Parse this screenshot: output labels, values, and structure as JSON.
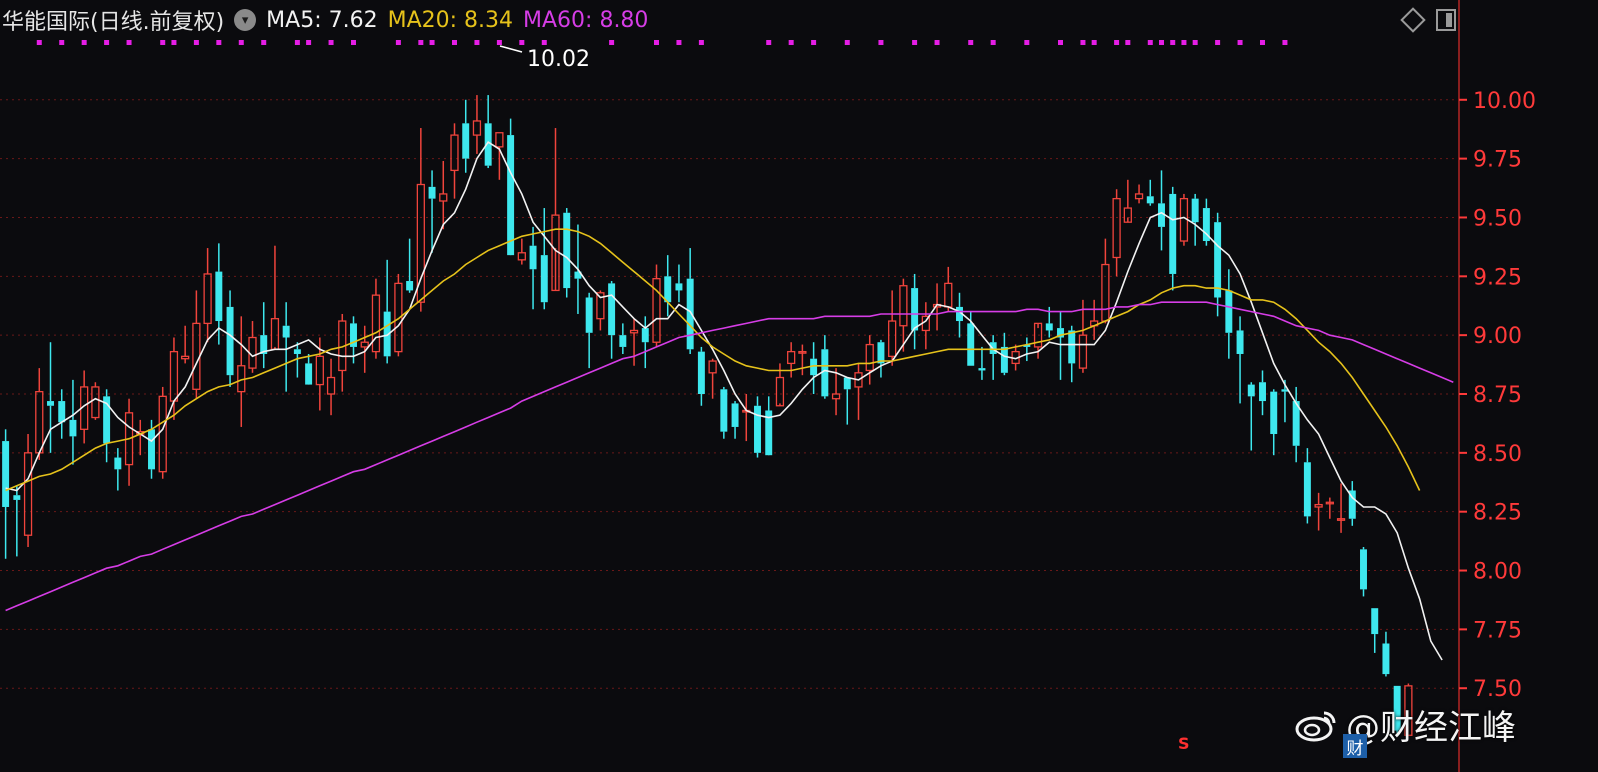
{
  "header": {
    "title": "华能国际(日线.前复权)",
    "ma5": "MA5: 7.62",
    "ma20": "MA20: 8.34",
    "ma60": "MA60: 8.80"
  },
  "watermark": {
    "text": "@财经江峰",
    "badge": "财",
    "marker": "S"
  },
  "icons": [
    "dropdown-icon",
    "diamond-icon",
    "panel-toggle-icon",
    "weibo-icon"
  ],
  "colors": {
    "background": "#0b0b0e",
    "up": "#f0443c",
    "down": "#3ee8ee",
    "ma5": "#f2f2f2",
    "ma20": "#e6c21b",
    "ma60": "#d63de6",
    "grid": "#6a1818",
    "axis_text": "#ff3a3a",
    "markers": "#e61ee6"
  },
  "chart_data": {
    "type": "candlestick",
    "title": "华能国际(日线.前复权)",
    "ylim": [
      7.28,
      10.22
    ],
    "y_ticks": [
      "10.00",
      "9.75",
      "9.50",
      "9.25",
      "9.00",
      "8.75",
      "8.50",
      "8.25",
      "8.00",
      "7.75",
      "7.50"
    ],
    "y_tick_values": [
      10.0,
      9.75,
      9.5,
      9.25,
      9.0,
      8.75,
      8.5,
      8.25,
      8.0,
      7.75,
      7.5
    ],
    "high_annotation": "10.02",
    "candles": [
      [
        8.55,
        8.27,
        8.05,
        8.6
      ],
      [
        8.32,
        8.3,
        8.06,
        8.36
      ],
      [
        8.15,
        8.5,
        8.1,
        8.58
      ],
      [
        8.5,
        8.76,
        8.47,
        8.86
      ],
      [
        8.72,
        8.7,
        8.5,
        8.97
      ],
      [
        8.72,
        8.63,
        8.56,
        8.77
      ],
      [
        8.64,
        8.57,
        8.45,
        8.81
      ],
      [
        8.6,
        8.78,
        8.54,
        8.85
      ],
      [
        8.65,
        8.78,
        8.64,
        8.8
      ],
      [
        8.74,
        8.54,
        8.46,
        8.77
      ],
      [
        8.48,
        8.43,
        8.34,
        8.52
      ],
      [
        8.45,
        8.67,
        8.36,
        8.73
      ],
      [
        8.58,
        8.59,
        8.49,
        8.64
      ],
      [
        8.6,
        8.43,
        8.39,
        8.64
      ],
      [
        8.42,
        8.74,
        8.39,
        8.78
      ],
      [
        8.72,
        8.93,
        8.64,
        8.99
      ],
      [
        8.9,
        8.91,
        8.88,
        9.04
      ],
      [
        8.77,
        9.05,
        8.73,
        9.19
      ],
      [
        9.05,
        9.26,
        8.97,
        9.37
      ],
      [
        9.27,
        9.06,
        8.96,
        9.39
      ],
      [
        9.12,
        8.83,
        8.78,
        9.19
      ],
      [
        8.76,
        8.87,
        8.61,
        9.08
      ],
      [
        8.86,
        8.99,
        8.84,
        9.06
      ],
      [
        9.0,
        8.92,
        8.86,
        9.14
      ],
      [
        8.94,
        9.07,
        8.95,
        9.38
      ],
      [
        9.04,
        8.99,
        8.76,
        9.14
      ],
      [
        8.94,
        8.92,
        8.82,
        8.97
      ],
      [
        8.88,
        8.79,
        8.8,
        8.92
      ],
      [
        8.79,
        8.91,
        8.68,
        8.99
      ],
      [
        8.75,
        8.82,
        8.66,
        8.9
      ],
      [
        8.85,
        9.06,
        8.76,
        9.09
      ],
      [
        9.05,
        8.95,
        8.88,
        9.08
      ],
      [
        8.95,
        8.97,
        8.84,
        9.04
      ],
      [
        8.93,
        9.17,
        8.9,
        9.24
      ],
      [
        9.1,
        8.91,
        8.88,
        9.32
      ],
      [
        8.93,
        9.22,
        8.91,
        9.26
      ],
      [
        9.23,
        9.19,
        9.18,
        9.41
      ],
      [
        9.14,
        9.64,
        9.1,
        9.88
      ],
      [
        9.63,
        9.58,
        9.35,
        9.7
      ],
      [
        9.57,
        9.6,
        9.45,
        9.74
      ],
      [
        9.7,
        9.85,
        9.58,
        9.9
      ],
      [
        9.9,
        9.75,
        9.69,
        10.0
      ],
      [
        9.85,
        9.91,
        9.77,
        10.02
      ],
      [
        9.9,
        9.72,
        9.71,
        10.02
      ],
      [
        9.8,
        9.86,
        9.66,
        9.86
      ],
      [
        9.85,
        9.34,
        9.44,
        9.92
      ],
      [
        9.32,
        9.35,
        9.3,
        9.41
      ],
      [
        9.38,
        9.28,
        9.11,
        9.46
      ],
      [
        9.34,
        9.14,
        9.11,
        9.54
      ],
      [
        9.19,
        9.51,
        9.37,
        9.88
      ],
      [
        9.52,
        9.2,
        9.16,
        9.54
      ],
      [
        9.27,
        9.24,
        9.09,
        9.47
      ],
      [
        9.16,
        9.01,
        8.86,
        9.18
      ],
      [
        9.07,
        9.18,
        9.02,
        9.19
      ],
      [
        9.22,
        9.0,
        8.9,
        9.23
      ],
      [
        9.0,
        8.95,
        8.92,
        9.05
      ],
      [
        9.01,
        9.02,
        8.87,
        9.07
      ],
      [
        9.03,
        8.97,
        8.86,
        9.08
      ],
      [
        8.97,
        9.24,
        8.95,
        9.3
      ],
      [
        9.25,
        9.14,
        9.08,
        9.34
      ],
      [
        9.22,
        9.19,
        9.14,
        9.3
      ],
      [
        9.24,
        8.94,
        8.92,
        9.37
      ],
      [
        8.93,
        8.75,
        8.7,
        8.95
      ],
      [
        8.84,
        8.89,
        8.73,
        8.9
      ],
      [
        8.77,
        8.59,
        8.56,
        8.78
      ],
      [
        8.71,
        8.61,
        8.56,
        8.72
      ],
      [
        8.68,
        8.68,
        8.55,
        8.75
      ],
      [
        8.7,
        8.5,
        8.48,
        8.74
      ],
      [
        8.68,
        8.49,
        8.52,
        8.74
      ],
      [
        8.7,
        8.82,
        8.71,
        8.88
      ],
      [
        8.88,
        8.93,
        8.82,
        8.97
      ],
      [
        8.93,
        8.93,
        8.83,
        8.96
      ],
      [
        8.9,
        8.83,
        8.75,
        8.97
      ],
      [
        8.94,
        8.74,
        8.73,
        9.0
      ],
      [
        8.73,
        8.75,
        8.66,
        8.86
      ],
      [
        8.82,
        8.77,
        8.62,
        8.82
      ],
      [
        8.78,
        8.84,
        8.64,
        8.88
      ],
      [
        8.85,
        8.96,
        8.79,
        9.0
      ],
      [
        8.97,
        8.88,
        8.82,
        8.98
      ],
      [
        8.91,
        9.06,
        8.87,
        9.19
      ],
      [
        9.04,
        9.21,
        8.93,
        9.24
      ],
      [
        9.2,
        9.02,
        8.94,
        9.26
      ],
      [
        9.02,
        9.08,
        8.94,
        9.14
      ],
      [
        9.12,
        9.13,
        9.02,
        9.22
      ],
      [
        9.12,
        9.22,
        9.1,
        9.29
      ],
      [
        9.12,
        9.06,
        8.99,
        9.18
      ],
      [
        9.05,
        8.87,
        8.87,
        9.1
      ],
      [
        8.86,
        8.85,
        8.81,
        8.95
      ],
      [
        8.97,
        8.92,
        8.81,
        9.0
      ],
      [
        8.95,
        8.84,
        8.83,
        9.01
      ],
      [
        8.88,
        8.93,
        8.85,
        8.96
      ],
      [
        8.96,
        8.95,
        8.89,
        8.99
      ],
      [
        8.95,
        9.05,
        8.9,
        9.03
      ],
      [
        9.05,
        9.02,
        8.99,
        9.12
      ],
      [
        9.03,
        8.99,
        8.81,
        9.1
      ],
      [
        9.02,
        8.88,
        8.8,
        9.04
      ],
      [
        8.86,
        9.0,
        8.84,
        9.15
      ],
      [
        9.04,
        9.06,
        8.98,
        9.15
      ],
      [
        9.06,
        9.3,
        9.05,
        9.41
      ],
      [
        9.33,
        9.58,
        9.25,
        9.62
      ],
      [
        9.48,
        9.54,
        9.5,
        9.66
      ],
      [
        9.58,
        9.6,
        9.56,
        9.64
      ],
      [
        9.59,
        9.56,
        9.55,
        9.66
      ],
      [
        9.56,
        9.46,
        9.36,
        9.7
      ],
      [
        9.6,
        9.26,
        9.19,
        9.63
      ],
      [
        9.4,
        9.58,
        9.38,
        9.6
      ],
      [
        9.58,
        9.48,
        9.38,
        9.6
      ],
      [
        9.54,
        9.4,
        9.38,
        9.58
      ],
      [
        9.48,
        9.16,
        9.08,
        9.52
      ],
      [
        9.19,
        9.01,
        8.9,
        9.28
      ],
      [
        9.02,
        8.92,
        8.71,
        9.08
      ],
      [
        8.79,
        8.74,
        8.51,
        8.8
      ],
      [
        8.8,
        8.72,
        8.66,
        8.85
      ],
      [
        8.76,
        8.58,
        8.49,
        8.77
      ],
      [
        8.77,
        8.76,
        8.63,
        8.81
      ],
      [
        8.72,
        8.53,
        8.46,
        8.78
      ],
      [
        8.46,
        8.23,
        8.2,
        8.52
      ],
      [
        8.27,
        8.28,
        8.17,
        8.33
      ],
      [
        8.29,
        8.29,
        8.22,
        8.31
      ],
      [
        8.22,
        8.22,
        8.16,
        8.37
      ],
      [
        8.34,
        8.22,
        8.19,
        8.38
      ],
      [
        8.09,
        7.92,
        7.89,
        8.1
      ],
      [
        7.84,
        7.73,
        7.65,
        7.84
      ],
      [
        7.69,
        7.56,
        7.55,
        7.74
      ],
      [
        7.51,
        7.32,
        7.31,
        7.51
      ],
      [
        7.3,
        7.51,
        7.3,
        7.52
      ]
    ],
    "series": [
      {
        "name": "MA5",
        "values": [
          8.35,
          8.34,
          8.39,
          8.5,
          8.6,
          8.63,
          8.66,
          8.7,
          8.73,
          8.71,
          8.65,
          8.61,
          8.58,
          8.55,
          8.6,
          8.72,
          8.78,
          8.88,
          8.98,
          9.03,
          9.0,
          8.96,
          8.91,
          8.93,
          8.94,
          8.94,
          8.96,
          8.98,
          8.94,
          8.92,
          8.91,
          8.91,
          8.93,
          8.99,
          9.0,
          9.04,
          9.11,
          9.24,
          9.36,
          9.47,
          9.52,
          9.62,
          9.75,
          9.82,
          9.79,
          9.69,
          9.6,
          9.48,
          9.42,
          9.36,
          9.33,
          9.28,
          9.21,
          9.16,
          9.17,
          9.12,
          9.07,
          9.03,
          9.07,
          9.07,
          9.13,
          9.1,
          9.02,
          8.94,
          8.85,
          8.75,
          8.68,
          8.66,
          8.65,
          8.66,
          8.71,
          8.77,
          8.82,
          8.85,
          8.84,
          8.82,
          8.81,
          8.84,
          8.87,
          8.89,
          8.96,
          9.03,
          9.06,
          9.13,
          9.12,
          9.1,
          9.06,
          9.0,
          8.94,
          8.91,
          8.9,
          8.92,
          8.93,
          8.97,
          8.96,
          8.96,
          8.96,
          8.96,
          9.02,
          9.14,
          9.27,
          9.39,
          9.5,
          9.52,
          9.49,
          9.5,
          9.47,
          9.43,
          9.38,
          9.34,
          9.26,
          9.14,
          9.01,
          8.88,
          8.79,
          8.71,
          8.64,
          8.58,
          8.48,
          8.38,
          8.31,
          8.27,
          8.27,
          8.24,
          8.16,
          8.01,
          7.88,
          7.7,
          7.62
        ]
      },
      {
        "name": "MA20",
        "values": [
          8.34,
          8.36,
          8.38,
          8.4,
          8.41,
          8.43,
          8.46,
          8.49,
          8.52,
          8.54,
          8.55,
          8.56,
          8.58,
          8.6,
          8.63,
          8.66,
          8.7,
          8.73,
          8.76,
          8.78,
          8.79,
          8.81,
          8.82,
          8.84,
          8.86,
          8.88,
          8.9,
          8.91,
          8.92,
          8.94,
          8.95,
          8.97,
          8.99,
          9.01,
          9.04,
          9.07,
          9.11,
          9.15,
          9.19,
          9.23,
          9.26,
          9.3,
          9.33,
          9.36,
          9.38,
          9.4,
          9.42,
          9.43,
          9.44,
          9.45,
          9.45,
          9.44,
          9.42,
          9.39,
          9.35,
          9.31,
          9.27,
          9.23,
          9.19,
          9.14,
          9.09,
          9.04,
          8.99,
          8.95,
          8.92,
          8.89,
          8.87,
          8.86,
          8.85,
          8.85,
          8.85,
          8.86,
          8.87,
          8.87,
          8.87,
          8.87,
          8.88,
          8.88,
          8.89,
          8.89,
          8.9,
          8.91,
          8.92,
          8.93,
          8.94,
          8.94,
          8.94,
          8.94,
          8.94,
          8.94,
          8.95,
          8.96,
          8.97,
          8.98,
          9.0,
          9.01,
          9.02,
          9.04,
          9.06,
          9.08,
          9.1,
          9.13,
          9.15,
          9.18,
          9.2,
          9.21,
          9.21,
          9.2,
          9.2,
          9.19,
          9.17,
          9.15,
          9.15,
          9.14,
          9.11,
          9.07,
          9.02,
          8.97,
          8.93,
          8.88,
          8.82,
          8.75,
          8.68,
          8.61,
          8.53,
          8.44,
          8.34
        ]
      },
      {
        "name": "MA60",
        "values": [
          7.83,
          7.85,
          7.87,
          7.89,
          7.91,
          7.93,
          7.95,
          7.97,
          7.99,
          8.01,
          8.02,
          8.04,
          8.06,
          8.07,
          8.09,
          8.11,
          8.13,
          8.15,
          8.17,
          8.19,
          8.21,
          8.23,
          8.24,
          8.26,
          8.28,
          8.3,
          8.32,
          8.34,
          8.36,
          8.38,
          8.4,
          8.42,
          8.43,
          8.45,
          8.47,
          8.49,
          8.51,
          8.53,
          8.55,
          8.57,
          8.59,
          8.61,
          8.63,
          8.65,
          8.67,
          8.69,
          8.72,
          8.74,
          8.76,
          8.78,
          8.8,
          8.82,
          8.84,
          8.86,
          8.88,
          8.9,
          8.91,
          8.93,
          8.95,
          8.97,
          8.99,
          9.0,
          9.01,
          9.02,
          9.03,
          9.04,
          9.05,
          9.06,
          9.07,
          9.07,
          9.07,
          9.07,
          9.07,
          9.08,
          9.08,
          9.08,
          9.08,
          9.08,
          9.09,
          9.09,
          9.09,
          9.09,
          9.09,
          9.09,
          9.1,
          9.1,
          9.1,
          9.1,
          9.1,
          9.1,
          9.1,
          9.11,
          9.11,
          9.1,
          9.1,
          9.1,
          9.11,
          9.11,
          9.11,
          9.12,
          9.12,
          9.13,
          9.13,
          9.14,
          9.14,
          9.14,
          9.14,
          9.14,
          9.13,
          9.12,
          9.11,
          9.1,
          9.09,
          9.08,
          9.06,
          9.04,
          9.03,
          9.02,
          9.0,
          8.99,
          8.98,
          8.96,
          8.94,
          8.92,
          8.9,
          8.88,
          8.86,
          8.84,
          8.82,
          8.8
        ]
      }
    ],
    "event_markers": [
      3,
      5,
      7,
      9,
      11,
      14,
      15,
      17,
      19,
      21,
      23,
      26,
      27,
      29,
      31,
      35,
      37,
      38,
      40,
      42,
      44,
      46,
      48,
      54,
      58,
      60,
      62,
      68,
      70,
      72,
      75,
      78,
      81,
      83,
      86,
      88,
      91,
      94,
      96,
      97,
      99,
      100,
      102,
      103,
      104,
      105,
      106,
      108,
      110,
      112,
      114
    ]
  }
}
